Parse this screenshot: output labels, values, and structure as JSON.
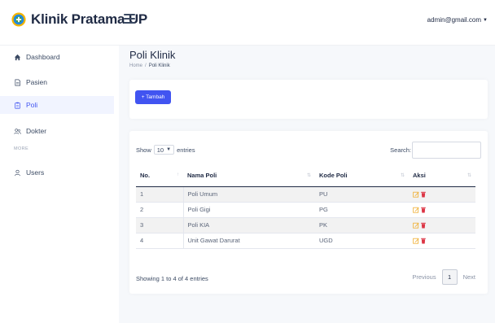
{
  "brand": {
    "name": "Klinik Pratama UP"
  },
  "user_menu": {
    "email": "admin@gmail.com"
  },
  "sidebar": {
    "items": [
      {
        "label": "Dashboard"
      },
      {
        "label": "Pasien"
      },
      {
        "label": "Poli"
      },
      {
        "label": "Dokter"
      }
    ],
    "section_heading": "MORE",
    "extra_items": [
      {
        "label": "Users"
      }
    ]
  },
  "page": {
    "title": "Poli Klinik",
    "breadcrumb": {
      "home": "Home",
      "separator": "/",
      "current": "Poli Klinik"
    }
  },
  "toolbar": {
    "add_label": "+ Tambah"
  },
  "table_controls": {
    "show_label": "Show",
    "page_size": "10",
    "entries_label": "entries",
    "search_label": "Search:"
  },
  "table": {
    "columns": [
      "No.",
      "Nama Poli",
      "Kode Poli",
      "Aksi"
    ],
    "rows": [
      {
        "no": "1",
        "nama": "Poli Umum",
        "kode": "PU"
      },
      {
        "no": "2",
        "nama": "Poli Gigi",
        "kode": "PG"
      },
      {
        "no": "3",
        "nama": "Poli KIA",
        "kode": "PK"
      },
      {
        "no": "4",
        "nama": "Unit Gawat Darurat",
        "kode": "UGD"
      }
    ]
  },
  "footer": {
    "info": "Showing 1 to 4 of 4 entries",
    "previous": "Previous",
    "current_page": "1",
    "next": "Next"
  },
  "colors": {
    "accent": "#4154f1",
    "edit_icon": "#f0ad2e",
    "delete_icon": "#dc3545"
  }
}
